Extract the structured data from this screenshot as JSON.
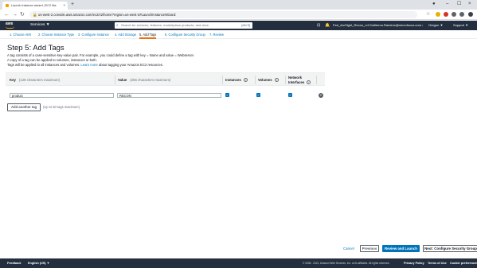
{
  "browser": {
    "tab_title": "Launch instance wizard | EC2 Ma",
    "tab_close": "×",
    "new_tab": "+",
    "url": "us-west-2.console.aws.amazon.com/ec2/v2/home?region=us-west-2#LaunchInstanceWizard:",
    "win_min": "–",
    "win_max": "☐",
    "win_close": "×"
  },
  "console_header": {
    "logo": "aws",
    "services_label": "Services ▼",
    "search_placeholder": "Search for services, features, marketplace products, and docs",
    "search_shortcut": "[Alt+S]",
    "account": "Fed_ArcSight_Recon_rvf.Guillermo.Ramirez@microfocus.com @0603... ▼",
    "region": "Oregon ▼",
    "support": "Support ▼"
  },
  "wizard_steps": [
    {
      "label": "1. Choose AMI"
    },
    {
      "label": "2. Choose Instance Type"
    },
    {
      "label": "3. Configure Instance"
    },
    {
      "label": "4. Add Storage"
    },
    {
      "label": "5. Add Tags"
    },
    {
      "label": "6. Configure Security Group"
    },
    {
      "label": "7. Review"
    }
  ],
  "content": {
    "title": "Step 5: Add Tags",
    "desc_line1": "A tag consists of a case-sensitive key-value pair. For example, you could define a tag with key = Name and value = Webserver.",
    "desc_line2": "A copy of a tag can be applied to volumes, instances or both.",
    "desc_line3_prefix": "Tags will be applied to all instances and volumes.",
    "desc_link": "Learn more",
    "desc_line3_suffix": "about tagging your Amazon EC2 resources."
  },
  "table": {
    "col_key": "Key",
    "col_key_hint": "(128 characters maximum)",
    "col_value": "Value",
    "col_value_hint": "(256 characters maximum)",
    "col_instances": "Instances",
    "col_volumes": "Volumes",
    "col_network_l1": "Network",
    "col_network_l2": "Interfaces",
    "info": "i",
    "rows": [
      {
        "key": "product",
        "value": "RECON",
        "instances": true,
        "volumes": true,
        "network": true
      }
    ]
  },
  "add_tag": {
    "button": "Add another tag",
    "hint": "(Up to 50 tags maximum)"
  },
  "footer_buttons": {
    "cancel": "Cancel",
    "previous": "Previous",
    "review": "Review and Launch",
    "next": "Next: Configure Security Group"
  },
  "footer": {
    "feedback": "Feedback",
    "language": "English (US) ▼",
    "copyright": "© 2008 - 2021, Amazon Web Services, Inc. or its affiliates. All rights reserved.",
    "privacy": "Privacy Policy",
    "terms": "Terms of Use",
    "cookies": "Cookie preferences"
  }
}
